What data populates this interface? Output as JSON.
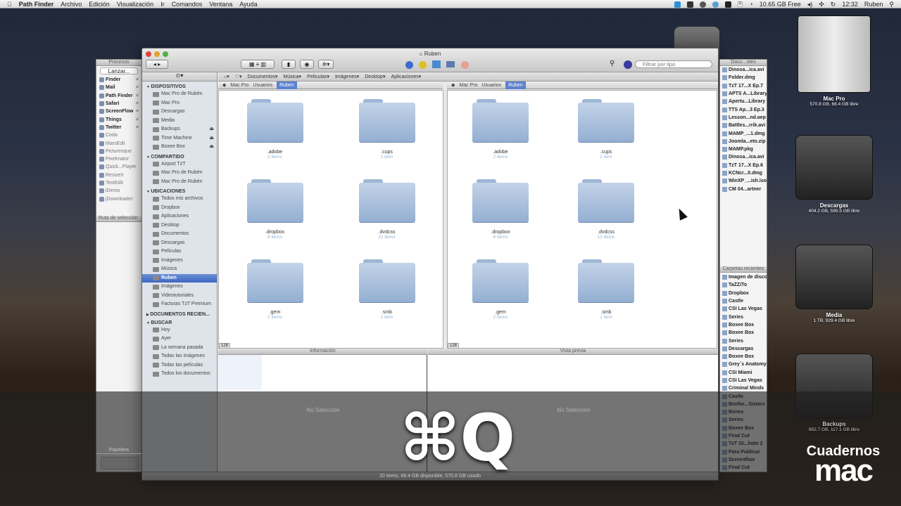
{
  "menubar": {
    "app": "Path Finder",
    "items": [
      "Archivo",
      "Edición",
      "Visualización",
      "Ir",
      "Comandos",
      "Ventana",
      "Ayuda"
    ],
    "status": {
      "free_space": "10.65 GB Free",
      "time": "12:32",
      "user": "Ruben",
      "calendar_day": "9"
    }
  },
  "processes": {
    "title": "Procesos",
    "launch": "Lanzar...",
    "running": [
      "Finder",
      "Mail",
      "Path Finder",
      "Safari",
      "ScreenFlow",
      "Things",
      "Twitter"
    ],
    "apps": [
      "Coda",
      "MarsEdit",
      "Picturesque",
      "Pixelmator",
      "Quick...Player",
      "ResizeIt",
      "TextEdit",
      "iDemo",
      "jDownloader"
    ],
    "selection_path": "Ruta de selección",
    "trash": "Papelera"
  },
  "window": {
    "title": "Ruben",
    "filter_placeholder": "Filtrar por tipo",
    "favorites": [
      "Documentos",
      "Música",
      "Películas",
      "Imágenes",
      "Desktop",
      "Aplicaciones"
    ],
    "breadcrumb": [
      "Mac Pro",
      "Usuarios",
      "Ruben"
    ],
    "sidebar": [
      {
        "header": "DISPOSITIVOS",
        "items": [
          {
            "label": "Mac Pro de Rubén"
          },
          {
            "label": "Mac Pro"
          },
          {
            "label": "Descargas"
          },
          {
            "label": "Media"
          },
          {
            "label": "Backups",
            "eject": true
          },
          {
            "label": "Time Machine",
            "eject": true
          },
          {
            "label": "Boxee Box",
            "eject": true
          }
        ]
      },
      {
        "header": "COMPARTIDO",
        "items": [
          {
            "label": "Airport TzT"
          },
          {
            "label": "Mac Pro de Rubén"
          },
          {
            "label": "Mac Pro de Rubén"
          }
        ]
      },
      {
        "header": "UBICACIONES",
        "items": [
          {
            "label": "Todos mis archivos"
          },
          {
            "label": "Dropbox"
          },
          {
            "label": "Aplicaciones"
          },
          {
            "label": "Desktop"
          },
          {
            "label": "Documentos"
          },
          {
            "label": "Descargas"
          },
          {
            "label": "Películas"
          },
          {
            "label": "Imágenes"
          },
          {
            "label": "Música"
          },
          {
            "label": "Ruben",
            "selected": true
          },
          {
            "label": "Imágenes"
          },
          {
            "label": "Videotutoriales"
          },
          {
            "label": "Facturas TzT Premium"
          }
        ]
      },
      {
        "header": "DOCUMENTOS RECIEN...",
        "items": []
      },
      {
        "header": "BUSCAR",
        "items": [
          {
            "label": "Hoy"
          },
          {
            "label": "Ayer"
          },
          {
            "label": "La semana pasada"
          },
          {
            "label": "Todas las imágenes"
          },
          {
            "label": "Todas las películas"
          },
          {
            "label": "Todos los documentos"
          }
        ]
      }
    ],
    "files": [
      {
        "name": ".adobe",
        "count": "2 items"
      },
      {
        "name": ".cups",
        "count": "1 item"
      },
      {
        "name": ".dropbox",
        "count": "8 items"
      },
      {
        "name": ".dvdcss",
        "count": "12 items"
      },
      {
        "name": ".gem",
        "count": "2 items"
      },
      {
        "name": ".smb",
        "count": "1 item"
      }
    ],
    "icon_size": "128",
    "info_title": "Información",
    "preview_title": "Vista previa",
    "no_selection": "No Selección",
    "status": "20 items, 68.4 GB disponible, 570.8 GB usado"
  },
  "drawer": {
    "title": "Docu...ntes",
    "documents": [
      "Dinosa...ica.avi",
      "Folder.dmg",
      "TzT 17...X Ep.7",
      "APTS A...Library",
      "Apertu...Library",
      "TTS Ap...3 Ep.3",
      "Lesson...nd.aep",
      "Battles...rrik.avi",
      "MAMP_...1.dmg",
      "Joomla...eto.zip",
      "MAMP.pkg",
      "Dinosa...ica.avi",
      "TzT 17...X Ep.6",
      "KCNcr...0.dmg",
      "WinXP_...ish.iso",
      "CM 04...artner"
    ],
    "recent_title": "Carpetas recientes",
    "recent": [
      "Imagen de disco",
      "TaZZiTo",
      "Dropbox",
      "Castle",
      "CSI Las Vegas",
      "Series",
      "Boxee Box",
      "Boxee Box",
      "Series",
      "Descargas",
      "Boxee Box",
      "Grey´s Anatomy",
      "CSI Miami",
      "CSI Las Vegas",
      "Criminal Minds",
      "Castle",
      "Brothe...Sisters",
      "Bones",
      "Series",
      "Boxee Box",
      "Final Cut",
      "TzT 10...hoto 2",
      "Para Publicar",
      "Screenflow",
      "Final Cut"
    ]
  },
  "desktop": [
    {
      "name": "Mac Pro",
      "info": "570.8 GB, 68.4 GB libre",
      "icon": "mac-pro-icon"
    },
    {
      "name": "Descargas",
      "info": "404.2 GB, 595.5 GB libre",
      "icon": "firewire-drive-icon"
    },
    {
      "name": "Media",
      "info": "1 TB, 929.4 GB libre",
      "icon": "film-drive-icon"
    },
    {
      "name": "Backups",
      "info": "882.7 GB, 117.1 GB libre",
      "icon": "firewire-drive-icon"
    }
  ],
  "overlay": {
    "shortcut": "⌘Q"
  },
  "logo": {
    "line1": "Cuadernos",
    "line2": "mac"
  },
  "colors": {
    "selection": "#3d66c2",
    "folder": "#a9c0de"
  }
}
